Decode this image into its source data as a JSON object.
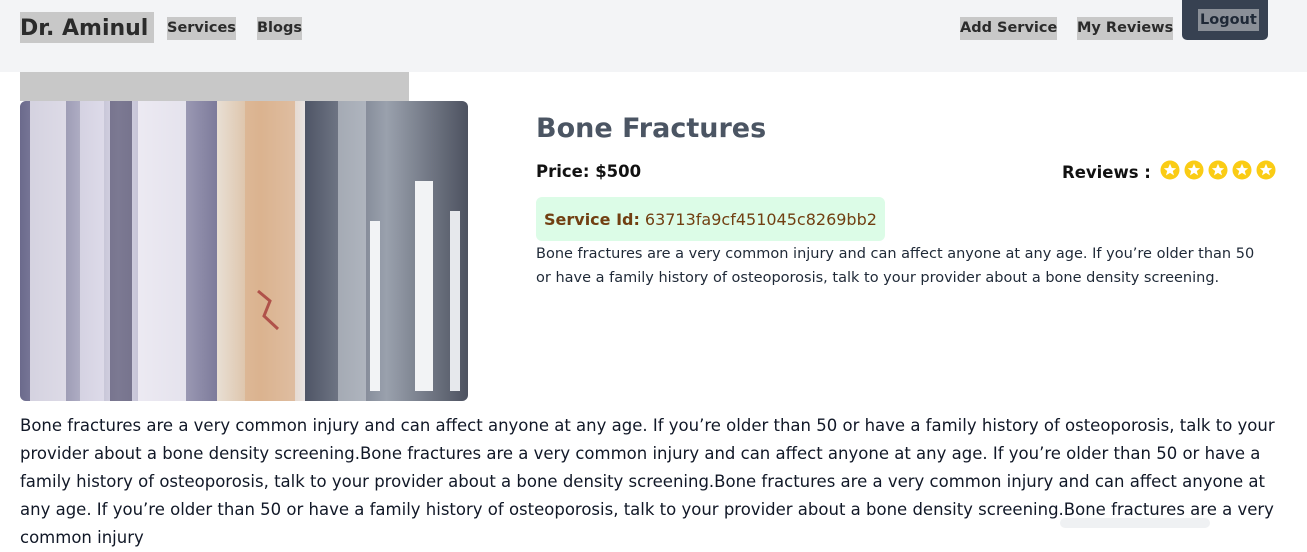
{
  "nav": {
    "brand": "Dr. Aminul",
    "links": [
      "Services",
      "Blogs"
    ],
    "add_service": "Add Service",
    "my_reviews": "My Reviews",
    "logout": "Logout"
  },
  "service": {
    "title": "Bone Fractures",
    "price": "Price: $500",
    "reviews_label": "Reviews :",
    "rating": 5,
    "id_label": "Service Id:",
    "id_value": "63713fa9cf451045c8269bb2",
    "short_description": "Bone fractures are a very common injury and can affect anyone at any age. If you’re older than 50 or have a family history of osteoporosis, talk to your provider about a bone density screening.",
    "long_description": "Bone fractures are a very common injury and can affect anyone at any age. If you’re older than 50 or have a family history of osteoporosis, talk to your provider about a bone density screening.Bone fractures are a very common injury and can affect anyone at any age. If you’re older than 50 or have a family history of osteoporosis, talk to your provider about a bone density screening.Bone fractures are a very common injury and can affect anyone at any age. If you’re older than 50 or have a family history of osteoporosis, talk to your provider about a bone density screening.Bone fractures are a very common injury"
  },
  "icons": {
    "star": "star-icon"
  },
  "colors": {
    "nav_bg": "#f3f4f6",
    "logout_bg": "#374151",
    "star": "#facc15",
    "service_id_bg": "#dcfce7",
    "title": "#4b5563"
  }
}
